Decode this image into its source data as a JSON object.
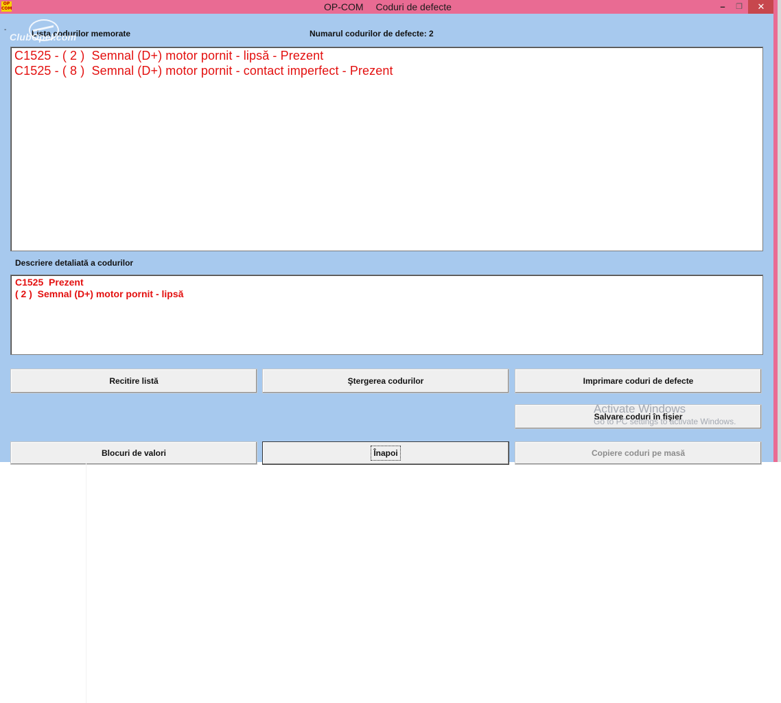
{
  "window": {
    "icon_text": "OP COM",
    "title_app": "OP-COM",
    "title_screen": "Coduri de defecte",
    "controls": {
      "minimize": "–",
      "maximize": "❐",
      "close": "✕"
    }
  },
  "watermark": {
    "logo_text": "ClubOpel.com"
  },
  "labels": {
    "stored_codes": "Lista codurilor memorate",
    "code_count": "Numarul codurilor de defecte: 2",
    "detailed_description": "Descriere detaliată a codurilor"
  },
  "codes": [
    "C1525 - ( 2 )  Semnal (D+) motor pornit - lipsă - Prezent",
    "C1525 - ( 8 )  Semnal (D+) motor pornit - contact imperfect - Prezent"
  ],
  "description": [
    "C1525  Prezent",
    "( 2 )  Semnal (D+) motor pornit - lipsă"
  ],
  "buttons": {
    "reread": "Recitire listă",
    "clear": "Ştergerea codurilor",
    "print": "Imprimare coduri de defecte",
    "save": "Salvare coduri în fişier",
    "blocks": "Blocuri de valori",
    "back": "Înapoi",
    "copy": "Copiere coduri pe masă"
  },
  "activation_notice": {
    "title": "Activate Windows",
    "subtitle": "Go to PC settings to activate Windows."
  },
  "colors": {
    "title_bar": "#e96b93",
    "client_bg": "#a7c9ee",
    "code_text": "#e3100f",
    "close_button": "#c7474d"
  }
}
